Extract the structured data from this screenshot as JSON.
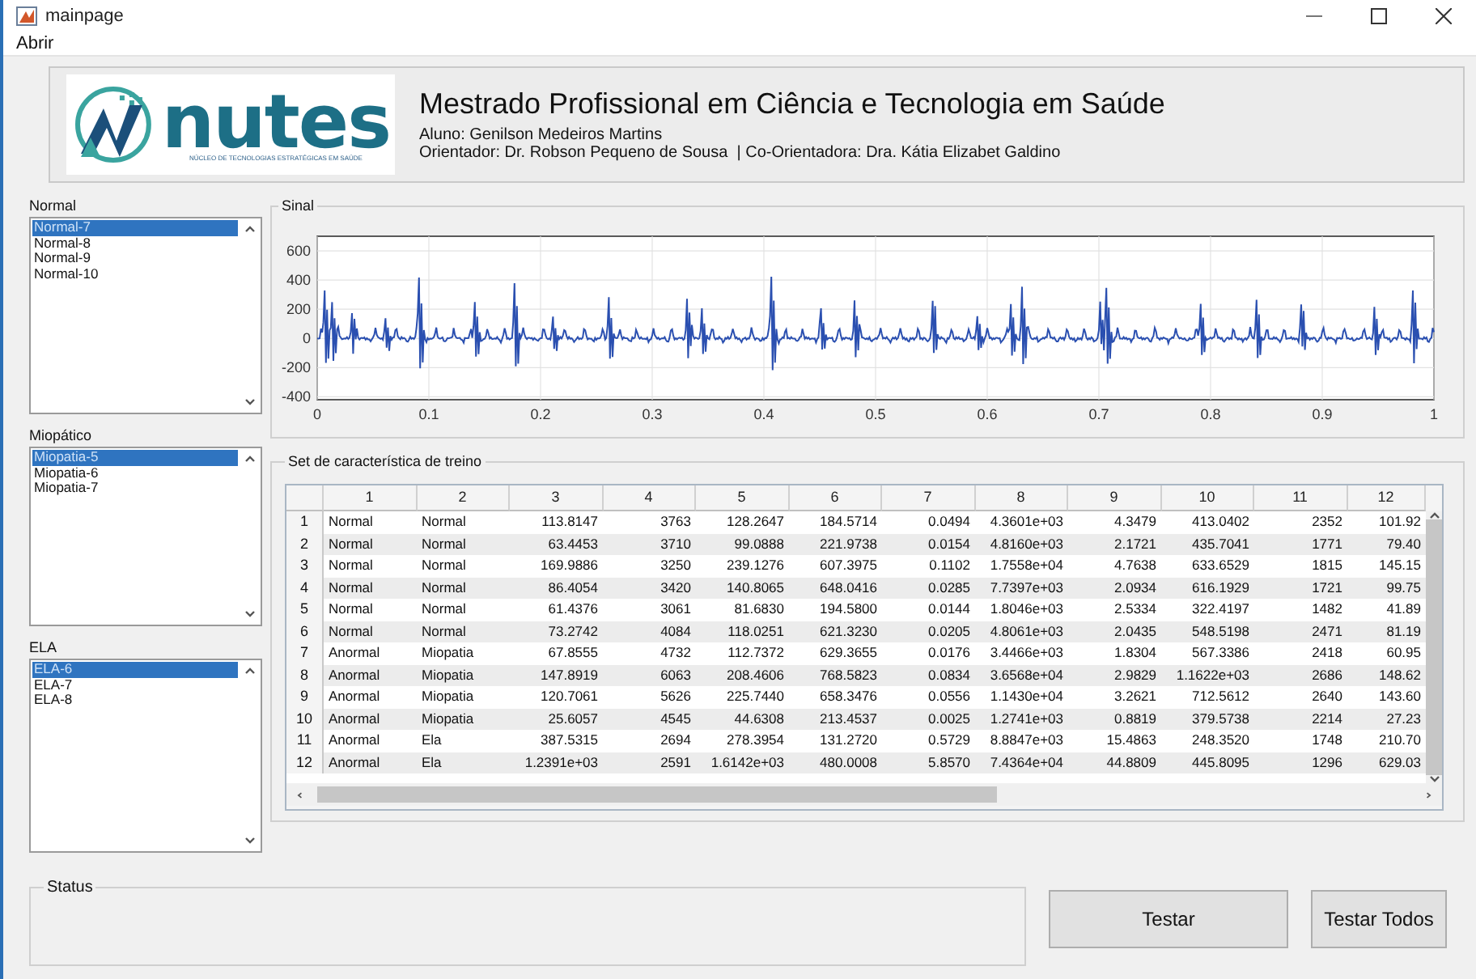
{
  "window": {
    "title": "mainpage"
  },
  "menu": [
    "Abrir"
  ],
  "header": {
    "title": "Mestrado Profissional em Ciência e Tecnologia em Saúde",
    "student": "Aluno: Genilson Medeiros Martins",
    "advisors": "Orientador: Dr. Robson Pequeno de Sousa  | Co-Orientadora: Dra. Kátia Elizabet Galdino",
    "logo": {
      "name": "nutes",
      "tagline": "NÚCLEO DE TECNOLOGIAS ESTRATÉGICAS EM SAÚDE"
    }
  },
  "lists": [
    {
      "label": "Normal",
      "items": [
        {
          "text": "Normal-7",
          "selected": true
        },
        {
          "text": "Normal-8",
          "selected": false
        },
        {
          "text": "Normal-9",
          "selected": false
        },
        {
          "text": "Normal-10",
          "selected": false
        }
      ]
    },
    {
      "label": "Miopático",
      "items": [
        {
          "text": "Miopatia-5",
          "selected": true
        },
        {
          "text": "Miopatia-6",
          "selected": false
        },
        {
          "text": "Miopatia-7",
          "selected": false
        }
      ]
    },
    {
      "label": "ELA",
      "items": [
        {
          "text": "ELA-6",
          "selected": true
        },
        {
          "text": "ELA-7",
          "selected": false
        },
        {
          "text": "ELA-8",
          "selected": false
        }
      ]
    }
  ],
  "signal": {
    "title": "Sinal",
    "y_ticks": [
      "600",
      "400",
      "200",
      "0",
      "-200",
      "-400"
    ],
    "x_ticks": [
      "0",
      "0.1",
      "0.2",
      "0.3",
      "0.4",
      "0.5",
      "0.6",
      "0.7",
      "0.8",
      "0.9",
      "1"
    ]
  },
  "table": {
    "title": "Set de característica de treino",
    "columns": [
      "1",
      "2",
      "3",
      "4",
      "5",
      "6",
      "7",
      "8",
      "9",
      "10",
      "11",
      "12"
    ],
    "rows": [
      {
        "index": "1",
        "cells": [
          "Normal",
          "Normal",
          "113.8147",
          "3763",
          "128.2647",
          "184.5714",
          "0.0494",
          "4.3601e+03",
          "4.3479",
          "413.0402",
          "2352",
          "101.92"
        ]
      },
      {
        "index": "2",
        "cells": [
          "Normal",
          "Normal",
          "63.4453",
          "3710",
          "99.0888",
          "221.9738",
          "0.0154",
          "4.8160e+03",
          "2.1721",
          "435.7041",
          "1771",
          "79.40"
        ]
      },
      {
        "index": "3",
        "cells": [
          "Normal",
          "Normal",
          "169.9886",
          "3250",
          "239.1276",
          "607.3975",
          "0.1102",
          "1.7558e+04",
          "4.7638",
          "633.6529",
          "1815",
          "145.15"
        ]
      },
      {
        "index": "4",
        "cells": [
          "Normal",
          "Normal",
          "86.4054",
          "3420",
          "140.8065",
          "648.0416",
          "0.0285",
          "7.7397e+03",
          "2.0934",
          "616.1929",
          "1721",
          "99.75"
        ]
      },
      {
        "index": "5",
        "cells": [
          "Normal",
          "Normal",
          "61.4376",
          "3061",
          "81.6830",
          "194.5800",
          "0.0144",
          "1.8046e+03",
          "2.5334",
          "322.4197",
          "1482",
          "41.89"
        ]
      },
      {
        "index": "6",
        "cells": [
          "Normal",
          "Normal",
          "73.2742",
          "4084",
          "118.0251",
          "621.3230",
          "0.0205",
          "4.8061e+03",
          "2.0435",
          "548.5198",
          "2471",
          "81.19"
        ]
      },
      {
        "index": "7",
        "cells": [
          "Anormal",
          "Miopatia",
          "67.8555",
          "4732",
          "112.7372",
          "629.3655",
          "0.0176",
          "3.4466e+03",
          "1.8304",
          "567.3386",
          "2418",
          "60.95"
        ]
      },
      {
        "index": "8",
        "cells": [
          "Anormal",
          "Miopatia",
          "147.8919",
          "6063",
          "208.4606",
          "768.5823",
          "0.0834",
          "3.6568e+04",
          "2.9829",
          "1.1622e+03",
          "2686",
          "148.62"
        ]
      },
      {
        "index": "9",
        "cells": [
          "Anormal",
          "Miopatia",
          "120.7061",
          "5626",
          "225.7440",
          "658.3476",
          "0.0556",
          "1.1430e+04",
          "3.2621",
          "712.5612",
          "2640",
          "143.60"
        ]
      },
      {
        "index": "10",
        "cells": [
          "Anormal",
          "Miopatia",
          "25.6057",
          "4545",
          "44.6308",
          "213.4537",
          "0.0025",
          "1.2741e+03",
          "0.8819",
          "379.5738",
          "2214",
          "27.23"
        ]
      },
      {
        "index": "11",
        "cells": [
          "Anormal",
          "Ela",
          "387.5315",
          "2694",
          "278.3954",
          "131.2720",
          "0.5729",
          "8.8847e+03",
          "15.4863",
          "248.3520",
          "1748",
          "210.70"
        ]
      },
      {
        "index": "12",
        "cells": [
          "Anormal",
          "Ela",
          "1.2391e+03",
          "2591",
          "1.6142e+03",
          "480.0008",
          "5.8570",
          "7.4364e+04",
          "44.8809",
          "445.8095",
          "1296",
          "629.03"
        ]
      }
    ]
  },
  "status": {
    "title": "Status"
  },
  "buttons": [
    "Testar",
    "Testar Todos"
  ]
}
